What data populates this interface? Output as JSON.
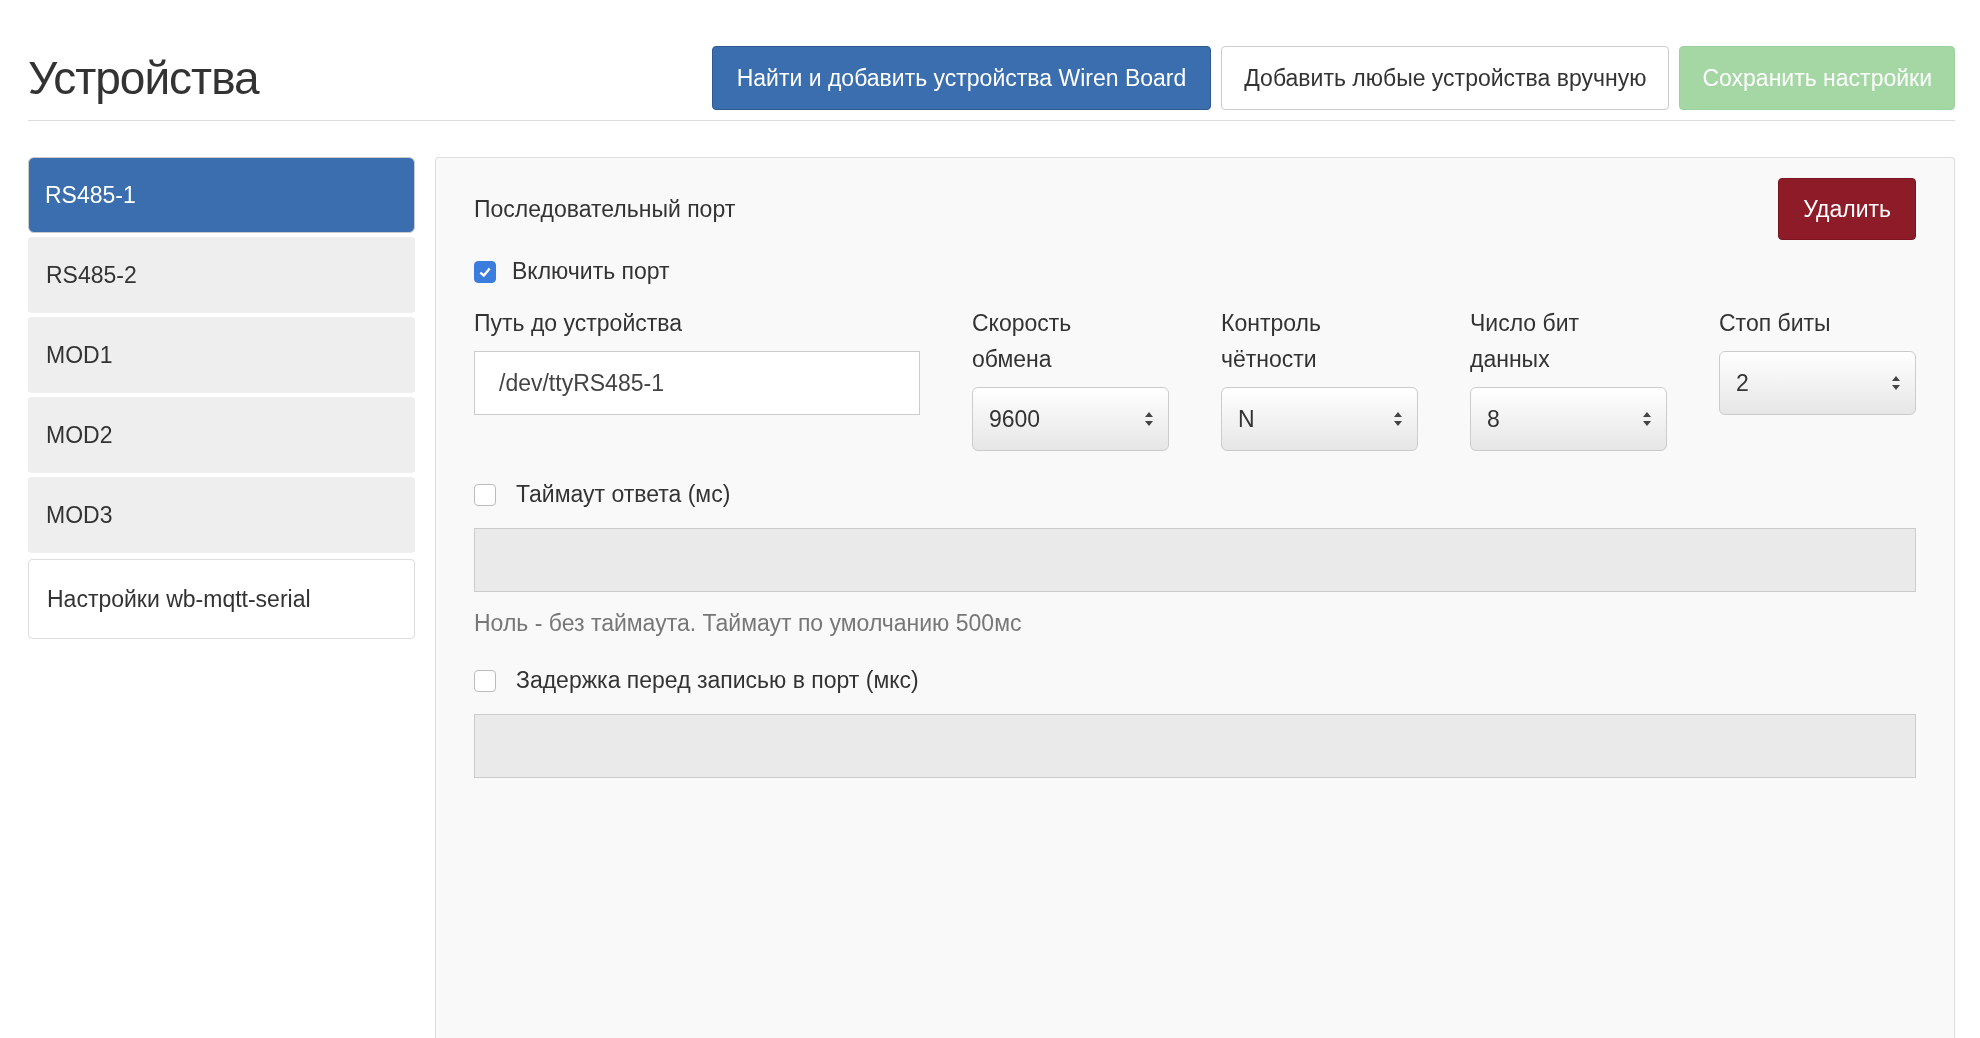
{
  "header": {
    "title": "Устройства",
    "buttons": [
      {
        "label": "Найти и добавить устройства Wiren Board",
        "kind": "primary",
        "disabled": false
      },
      {
        "label": "Добавить любые устройства вручную",
        "kind": "default",
        "disabled": false
      },
      {
        "label": "Сохранить настройки",
        "kind": "success",
        "disabled": true
      }
    ]
  },
  "sidebar": {
    "items": [
      {
        "label": "RS485-1",
        "kind": "port",
        "selected": true
      },
      {
        "label": "RS485-2",
        "kind": "port",
        "selected": false
      },
      {
        "label": "MOD1",
        "kind": "port",
        "selected": false
      },
      {
        "label": "MOD2",
        "kind": "port",
        "selected": false
      },
      {
        "label": "MOD3",
        "kind": "port",
        "selected": false
      },
      {
        "label": "Настройки wb-mqtt-serial",
        "kind": "settings",
        "selected": false
      }
    ]
  },
  "panel": {
    "title": "Последовательный порт",
    "delete_button": "Удалить",
    "enable_port": {
      "label": "Включить порт",
      "checked": true
    },
    "path": {
      "label": "Путь до устройства",
      "value": "/dev/ttyRS485-1"
    },
    "selects": [
      {
        "label": "Скорость обмена",
        "value": "9600"
      },
      {
        "label": "Контроль чётности",
        "value": "N"
      },
      {
        "label": "Число бит данных",
        "value": "8"
      },
      {
        "label": "Стоп биты",
        "value": "2"
      }
    ],
    "options": [
      {
        "label": "Таймаут ответа (мс)",
        "checked": false,
        "disabled": true,
        "help": "Ноль - без таймаута. Таймаут по умолчанию 500мс"
      },
      {
        "label": "Задержка перед записью в порт (мкс)",
        "checked": false,
        "disabled": true
      }
    ]
  }
}
